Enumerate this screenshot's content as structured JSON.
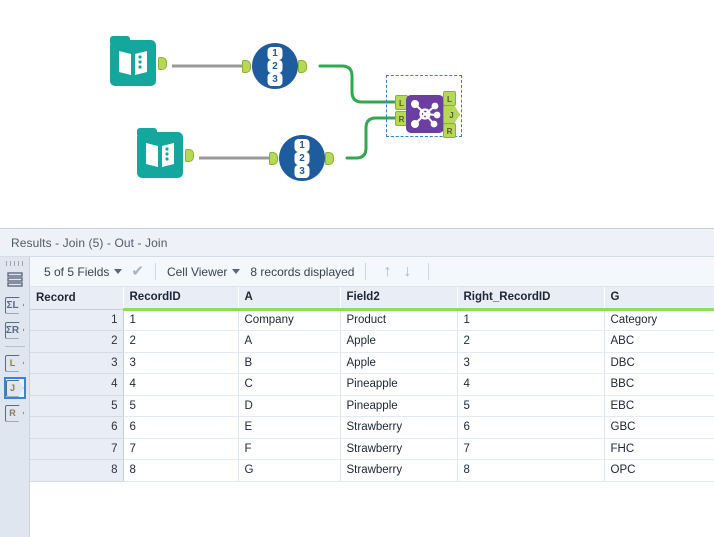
{
  "canvas": {
    "tools": [
      {
        "id": "input1",
        "type": "input-data",
        "icon": "book-icon",
        "output_anchor": ""
      },
      {
        "id": "recordid1",
        "type": "record-id",
        "icon": "record-id-icon",
        "badges": [
          "1",
          "2",
          "3"
        ],
        "input_anchor": "",
        "output_anchor": ""
      },
      {
        "id": "input2",
        "type": "input-data",
        "icon": "book-icon",
        "output_anchor": ""
      },
      {
        "id": "recordid2",
        "type": "record-id",
        "icon": "record-id-icon",
        "badges": [
          "1",
          "2",
          "3"
        ],
        "input_anchor": "",
        "output_anchor": ""
      }
    ],
    "join_tool": {
      "id": "join5",
      "icon": "join-icon",
      "selected": true,
      "input_anchors": [
        "L",
        "R"
      ],
      "output_anchors": [
        "L",
        "J",
        "R"
      ]
    },
    "colors": {
      "input_tool": "#14a79d",
      "recordid_tool": "#1f5c9e",
      "join_tool": "#6b3fa0",
      "anchor": "#b5d957",
      "connection_active": "#2faa4e",
      "connection_idle": "#9a9a9a",
      "selection": "#2f7fd1"
    }
  },
  "results": {
    "title": "Results - Join (5) - Out - Join",
    "rail": {
      "grip": "drag-grip",
      "buttons": [
        {
          "name": "messages",
          "label": "",
          "icon": "stack-icon",
          "selected": false
        },
        {
          "name": "summary-left",
          "label": "L",
          "icon": "sigma-l-icon",
          "selected": false
        },
        {
          "name": "summary-right",
          "label": "R",
          "icon": "sigma-r-icon",
          "selected": false
        },
        {
          "name": "anchor-l",
          "label": "L",
          "icon": "anchor-l-icon",
          "selected": false
        },
        {
          "name": "anchor-j",
          "label": "J",
          "icon": "anchor-j-icon",
          "selected": true
        },
        {
          "name": "anchor-r",
          "label": "R",
          "icon": "anchor-r-icon",
          "selected": false
        }
      ]
    },
    "toolbar": {
      "fields_label": "5 of 5 Fields",
      "apply_icon": "checkmark-icon",
      "viewer_label": "Cell Viewer",
      "records_label": "8 records displayed",
      "up_icon": "arrow-up-icon",
      "down_icon": "arrow-down-icon"
    },
    "table": {
      "record_header": "Record",
      "columns": [
        "RecordID",
        "A",
        "Field2",
        "Right_RecordID",
        "G"
      ],
      "rows": [
        {
          "record": "1",
          "cells": [
            "1",
            "Company",
            "Product",
            "1",
            "Category"
          ]
        },
        {
          "record": "2",
          "cells": [
            "2",
            "A",
            "Apple",
            "2",
            "ABC"
          ]
        },
        {
          "record": "3",
          "cells": [
            "3",
            "B",
            "Apple",
            "3",
            "DBC"
          ]
        },
        {
          "record": "4",
          "cells": [
            "4",
            "C",
            "Pineapple",
            "4",
            "BBC"
          ]
        },
        {
          "record": "5",
          "cells": [
            "5",
            "D",
            "Pineapple",
            "5",
            "EBC"
          ]
        },
        {
          "record": "6",
          "cells": [
            "6",
            "E",
            "Strawberry",
            "6",
            "GBC"
          ]
        },
        {
          "record": "7",
          "cells": [
            "7",
            "F",
            "Strawberry",
            "7",
            "FHC"
          ]
        },
        {
          "record": "8",
          "cells": [
            "8",
            "G",
            "Strawberry",
            "8",
            "OPC"
          ]
        }
      ],
      "header_underline_color": "#8ede54"
    }
  }
}
